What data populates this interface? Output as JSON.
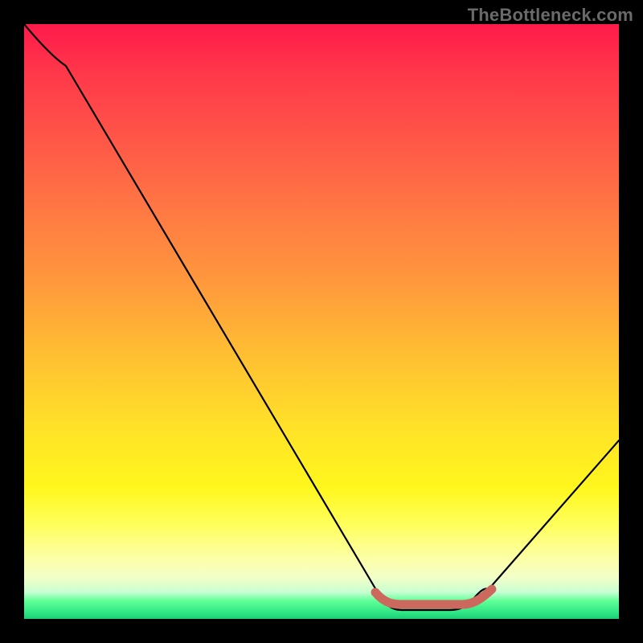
{
  "watermark": "TheBottleneck.com",
  "chart_data": {
    "type": "line",
    "title": "",
    "xlabel": "",
    "ylabel": "",
    "xlim": [
      0,
      100
    ],
    "ylim": [
      0,
      100
    ],
    "grid": false,
    "legend": false,
    "gradient": {
      "direction": "vertical",
      "stops": [
        {
          "pct": 0,
          "color": "#ff1a4b"
        },
        {
          "pct": 9,
          "color": "#ff3a4a"
        },
        {
          "pct": 20,
          "color": "#ff5848"
        },
        {
          "pct": 32,
          "color": "#ff7a43"
        },
        {
          "pct": 44,
          "color": "#ff9a3c"
        },
        {
          "pct": 55,
          "color": "#ffbd33"
        },
        {
          "pct": 68,
          "color": "#ffe228"
        },
        {
          "pct": 78,
          "color": "#fff71d"
        },
        {
          "pct": 84,
          "color": "#ffff5a"
        },
        {
          "pct": 90,
          "color": "#fcffa8"
        },
        {
          "pct": 95.5,
          "color": "#c8ffd2"
        },
        {
          "pct": 97,
          "color": "#5dff96"
        },
        {
          "pct": 100,
          "color": "#1bcc74"
        }
      ]
    },
    "series": [
      {
        "name": "bottleneck-curve",
        "x": [
          0,
          4,
          7,
          60,
          63,
          72,
          75,
          78,
          100
        ],
        "y": [
          100,
          96,
          93.5,
          3.5,
          1.5,
          1.5,
          3,
          5,
          30
        ]
      }
    ],
    "marker": {
      "name": "optimal-range-marker",
      "x": [
        59,
        63,
        74,
        78.5
      ],
      "y": [
        4.5,
        2.5,
        2.5,
        5
      ],
      "stroke": "#cd685e"
    }
  }
}
